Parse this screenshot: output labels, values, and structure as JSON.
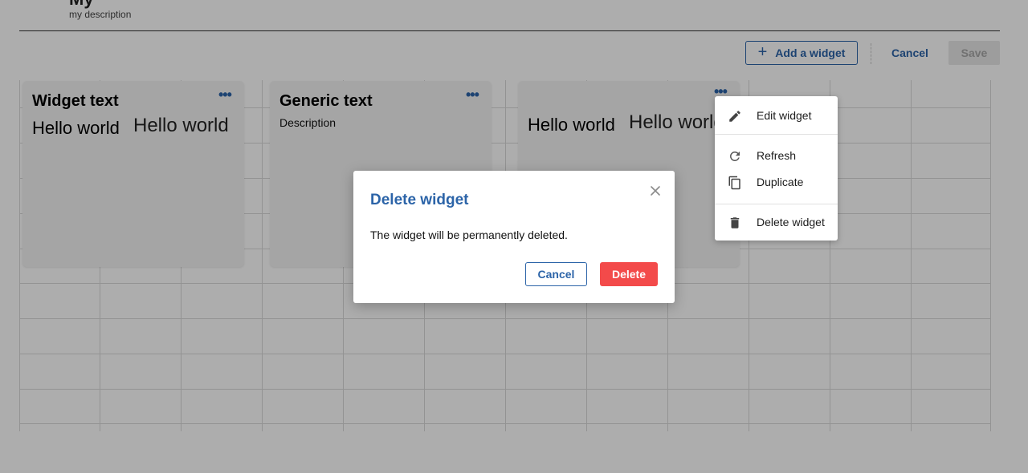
{
  "page": {
    "title": "My",
    "description": "my description"
  },
  "toolbar": {
    "add_widget_label": "Add a widget",
    "add_icon": "plus-icon",
    "cancel_label": "Cancel",
    "save_label": "Save"
  },
  "widgets": [
    {
      "title": "Widget text",
      "text_a": "Hello world",
      "text_b": "Hello world",
      "menu_icon": "more-horizontal-icon"
    },
    {
      "title": "Generic text",
      "description": "Description",
      "menu_icon": "more-horizontal-icon"
    },
    {
      "text_a": "Hello world",
      "text_b": "Hello world",
      "menu_icon": "more-horizontal-icon"
    }
  ],
  "context_menu": {
    "items": [
      {
        "label": "Edit widget",
        "icon": "pencil-icon"
      },
      {
        "label": "Refresh",
        "icon": "refresh-icon"
      },
      {
        "label": "Duplicate",
        "icon": "copy-icon"
      },
      {
        "label": "Delete widget",
        "icon": "trash-icon"
      }
    ]
  },
  "dialog": {
    "title": "Delete widget",
    "message": "The widget will be permanently deleted.",
    "cancel_label": "Cancel",
    "delete_label": "Delete",
    "close_icon": "close-icon"
  },
  "colors": {
    "primary": "#2c64a8",
    "danger": "#f34a4a",
    "overlay": "rgba(0,0,0,0.32)",
    "disabled_bg": "#e7e7e7"
  }
}
